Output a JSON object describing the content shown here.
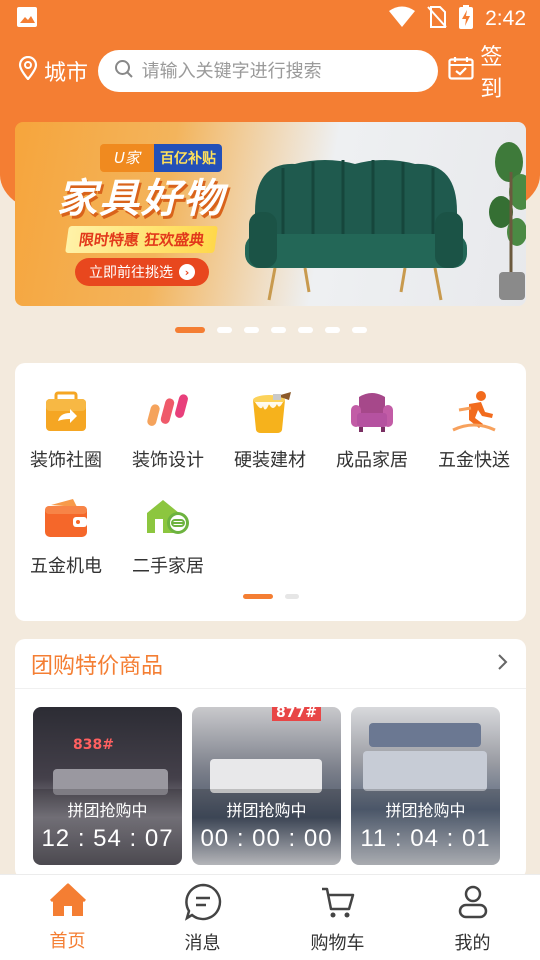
{
  "status_bar": {
    "time": "2:42"
  },
  "header": {
    "city": "城市",
    "search_placeholder": "请输入关键字进行搜索",
    "signin": "签到"
  },
  "banner": {
    "tag_left": "U家",
    "tag_right": "百亿补贴",
    "title": "家具好物",
    "subtitle": "限时特惠 狂欢盛典",
    "button": "立即前往挑选"
  },
  "categories": [
    {
      "label": "装饰社圈",
      "icon": "folder-share-icon"
    },
    {
      "label": "装饰设计",
      "icon": "brush-strokes-icon"
    },
    {
      "label": "硬装建材",
      "icon": "paint-bucket-icon"
    },
    {
      "label": "成品家居",
      "icon": "armchair-icon"
    },
    {
      "label": "五金快送",
      "icon": "delivery-runner-icon"
    },
    {
      "label": "五金机电",
      "icon": "wallet-icon"
    },
    {
      "label": "二手家居",
      "icon": "house-link-icon"
    }
  ],
  "group_buy": {
    "title": "团购特价商品",
    "products": [
      {
        "status": "拼团抢购中",
        "countdown": "12 : 54 : 07",
        "signage": "838#"
      },
      {
        "status": "拼团抢购中",
        "countdown": "00 : 00 : 00",
        "signage": "877#"
      },
      {
        "status": "拼团抢购中",
        "countdown": "11 : 04 : 01",
        "signage": ""
      }
    ]
  },
  "tabs": [
    {
      "label": "首页",
      "icon": "home-icon",
      "active": true
    },
    {
      "label": "消息",
      "icon": "message-icon",
      "active": false
    },
    {
      "label": "购物车",
      "icon": "cart-icon",
      "active": false
    },
    {
      "label": "我的",
      "icon": "profile-icon",
      "active": false
    }
  ],
  "colors": {
    "accent": "#f47e33",
    "background": "#f3eadd"
  }
}
